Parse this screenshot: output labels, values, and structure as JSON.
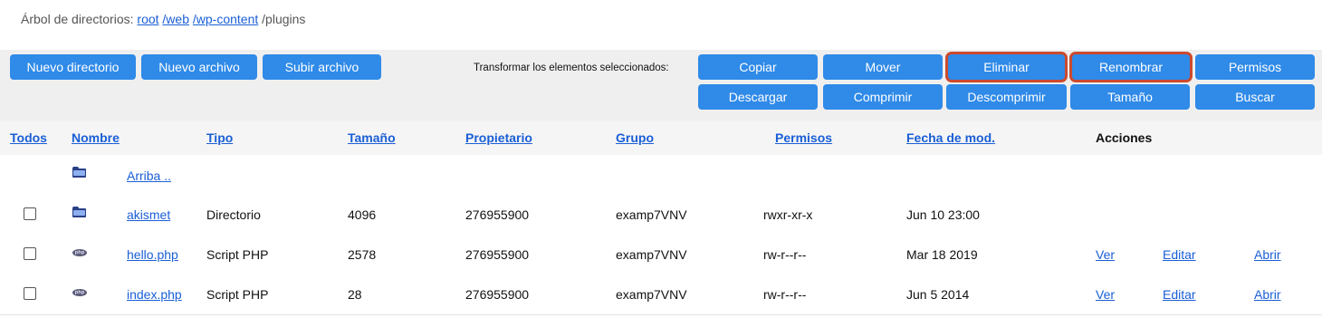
{
  "breadcrumb": {
    "prefix": "Árbol de directorios:",
    "root": "root",
    "web": "/web",
    "wp_content": "/wp-content",
    "current": "/plugins"
  },
  "toolbar": {
    "new_dir": "Nuevo directorio",
    "new_file": "Nuevo archivo",
    "upload": "Subir archivo",
    "transform_label": "Transformar los elementos seleccionados:",
    "copy": "Copiar",
    "move": "Mover",
    "delete": "Eliminar",
    "rename": "Renombrar",
    "permissions": "Permisos",
    "download": "Descargar",
    "compress": "Comprimir",
    "decompress": "Descomprimir",
    "size": "Tamaño",
    "search": "Buscar"
  },
  "columns": {
    "all": "Todos",
    "name": "Nombre",
    "type": "Tipo",
    "size": "Tamaño",
    "owner": "Propietario",
    "group": "Grupo",
    "perms": "Permisos",
    "mtime": "Fecha de mod.",
    "actions": "Acciones"
  },
  "up_row": {
    "label": "Arriba .."
  },
  "rows": [
    {
      "name": "akismet",
      "type": "Directorio",
      "size": "4096",
      "owner": "276955900",
      "group": "examp7VNV",
      "perms": "rwxr-xr-x",
      "mtime": "Jun 10 23:00",
      "icon": "folder-icon"
    },
    {
      "name": "hello.php",
      "type": "Script PHP",
      "size": "2578",
      "owner": "276955900",
      "group": "examp7VNV",
      "perms": "rw-r--r--",
      "mtime": "Mar 18 2019",
      "icon": "php-icon",
      "view": "Ver",
      "edit": "Editar",
      "open": "Abrir"
    },
    {
      "name": "index.php",
      "type": "Script PHP",
      "size": "28",
      "owner": "276955900",
      "group": "examp7VNV",
      "perms": "rw-r--r--",
      "mtime": "Jun 5 2014",
      "icon": "php-icon",
      "view": "Ver",
      "edit": "Editar",
      "open": "Abrir"
    }
  ],
  "colors": {
    "button": "#2f8ae8",
    "highlight": "#cc4a2d",
    "link": "#1a5fd6"
  }
}
